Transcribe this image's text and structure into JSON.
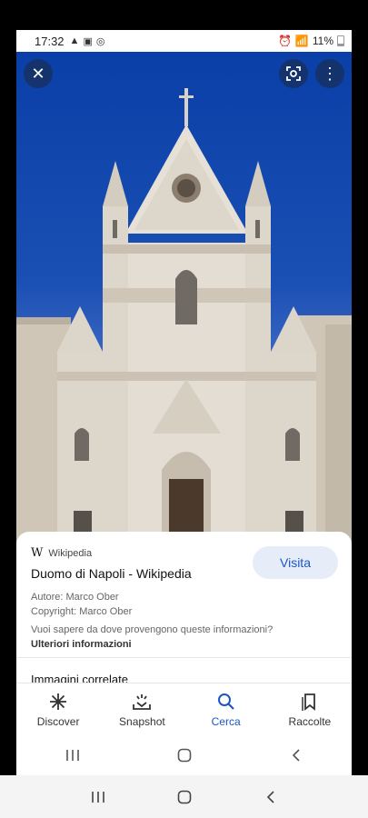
{
  "status_bar": {
    "time": "17:32",
    "left_icons": [
      "alert-icon",
      "image-icon",
      "messenger-icon"
    ],
    "battery": "11%"
  },
  "photo": {
    "subject": "Duomo di Napoli facade",
    "sky_color": "#1a4fb3",
    "stone_color": "#d9d2c7"
  },
  "card": {
    "source": "Wikipedia",
    "title": "Duomo di Napoli - Wikipedia",
    "visit_label": "Visita",
    "author": "Autore: Marco Ober",
    "copyright": "Copyright: Marco Ober",
    "question": "Vuoi sapere da dove provengono queste informazioni?",
    "more_info": "Ulteriori informazioni"
  },
  "related_title": "Immagini correlate",
  "tabs": [
    {
      "label": "Discover",
      "icon": "asterisk-icon",
      "active": false
    },
    {
      "label": "Snapshot",
      "icon": "snapshot-icon",
      "active": false
    },
    {
      "label": "Cerca",
      "icon": "search-icon",
      "active": true
    },
    {
      "label": "Raccolte",
      "icon": "bookmark-icon",
      "active": false
    }
  ],
  "colors": {
    "accent": "#1a57c4",
    "visit_bg": "#e6edf9"
  }
}
